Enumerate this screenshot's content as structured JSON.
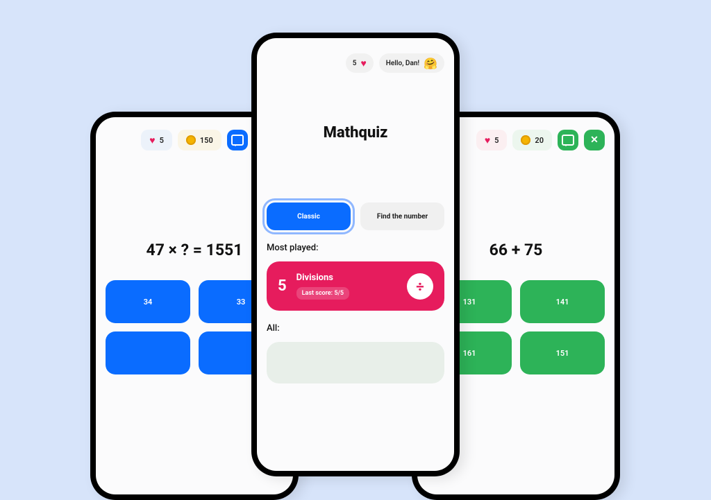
{
  "colors": {
    "blue": "#0a6cff",
    "green": "#2db358",
    "pink": "#e61c5d",
    "bg": "#D7E4FA"
  },
  "left": {
    "hearts": "5",
    "coins": "150",
    "question": "47 × ?  =  1551",
    "answers": [
      "34",
      "33"
    ],
    "answers_row2": [
      "",
      ""
    ]
  },
  "right": {
    "hearts": "5",
    "coins": "20",
    "question": "66 + 75",
    "answers": [
      "131",
      "141"
    ],
    "answers_row2": [
      "161",
      "151"
    ]
  },
  "center": {
    "hearts": "5",
    "greeting": "Hello, Dan!",
    "emoji": "🤗",
    "title": "Mathquiz",
    "modes": {
      "active": "Classic",
      "inactive": "Find the number"
    },
    "sections": {
      "most_played": "Most played:",
      "all": "All:"
    },
    "featured": {
      "count": "5",
      "name": "Divisions",
      "score_label": "Last score: 5/5",
      "op_symbol": "÷"
    }
  }
}
